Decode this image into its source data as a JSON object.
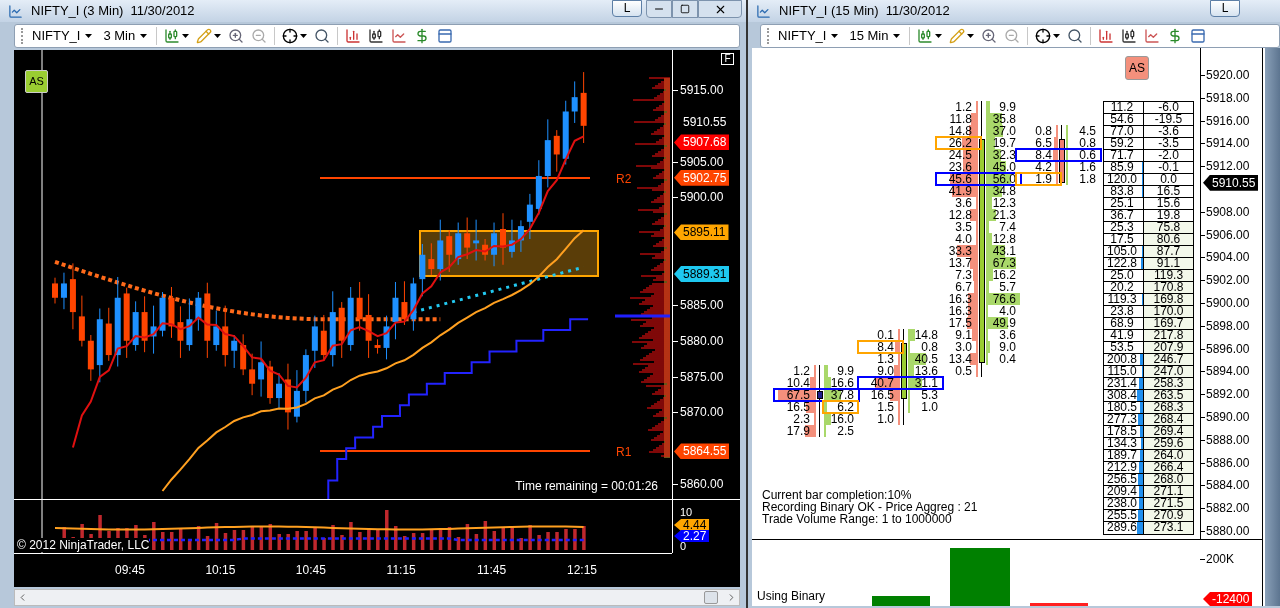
{
  "left_window": {
    "title": "NIFTY_I (3 Min)",
    "date": "11/30/2012",
    "title_buttons": [
      "L"
    ],
    "controls": true,
    "toolbar": {
      "instrument": "NIFTY_I",
      "interval": "3 Min"
    },
    "chart": {
      "as_button": "AS",
      "f_button": "F",
      "price_ticks": [
        "5915.00",
        "5905.00",
        "5900.00",
        "5885.00",
        "5880.00",
        "5875.00",
        "5870.00",
        "5860.00"
      ],
      "price_tags": [
        {
          "text": "5910.55",
          "color": "#000000"
        },
        {
          "text": "5907.68",
          "color": "#ff0000"
        },
        {
          "text": "5902.75",
          "color": "#ff4500"
        },
        {
          "text": "5895.11",
          "color": "#ffa500"
        },
        {
          "text": "5889.31",
          "color": "#1ec8f0"
        },
        {
          "text": "5864.55",
          "color": "#ff4500"
        }
      ],
      "levels": [
        "R2",
        "R1"
      ],
      "time_remaining": "Time remaining = 00:01:26",
      "volume_ticks": [
        "10",
        "0"
      ],
      "volume_tags": [
        {
          "text": "4.44",
          "color": "#ffa500"
        },
        {
          "text": "2.27",
          "color": "#0000ff"
        }
      ],
      "copyright": "© 2012 NinjaTrader, LLC",
      "time_labels": [
        "09:45",
        "10:15",
        "10:45",
        "11:15",
        "11:45",
        "12:15"
      ]
    }
  },
  "right_window": {
    "title": "NIFTY_I (15 Min)",
    "date": "11/30/2012",
    "title_buttons": [
      "L"
    ],
    "controls": false,
    "toolbar": {
      "instrument": "NIFTY_I",
      "interval": "15 Min"
    },
    "chart": {
      "as_button": "AS",
      "footprint": [
        {
          "kind": "flat",
          "rows": [
            {
              "bid": "1.2",
              "ask": "9.9",
              "bid_boxed": false,
              "ask_boxed": false
            },
            {
              "bid": "10.4",
              "ask": "16.6",
              "bid_boxed": false,
              "ask_boxed": false
            },
            {
              "bid": "67.5",
              "ask": "37.8",
              "bid_boxed": true,
              "ask_boxed": true,
              "color": "#0000ff"
            },
            {
              "bid": "16.5",
              "ask": "6.2",
              "bid_boxed": false,
              "ask_boxed": true,
              "color": "#ffa500"
            },
            {
              "bid": "2.3",
              "ask": "16.0",
              "bid_boxed": false,
              "ask_boxed": false
            },
            {
              "bid": "17.9",
              "ask": "2.5",
              "bid_boxed": false,
              "ask_boxed": false
            }
          ]
        },
        {
          "kind": "up",
          "rows": [
            {
              "bid": "0.1",
              "ask": "14.8",
              "bid_boxed": false,
              "ask_boxed": false
            },
            {
              "bid": "8.4",
              "ask": "0.8",
              "bid_boxed": true,
              "ask_boxed": false,
              "color": "#ffa500"
            },
            {
              "bid": "1.3",
              "ask": "40.5",
              "bid_boxed": false,
              "ask_boxed": false
            },
            {
              "bid": "9.0",
              "ask": "13.6",
              "bid_boxed": false,
              "ask_boxed": false
            },
            {
              "bid": "40.7",
              "ask": "31.1",
              "bid_boxed": true,
              "ask_boxed": true,
              "color": "#0000ff"
            },
            {
              "bid": "16.5",
              "ask": "5.3",
              "bid_boxed": false,
              "ask_boxed": false
            },
            {
              "bid": "1.5",
              "ask": "1.0",
              "bid_boxed": false,
              "ask_boxed": false
            },
            {
              "bid": "1.0",
              "bid_boxed": false,
              "ask_boxed": false
            }
          ]
        },
        {
          "kind": "up",
          "rows": [
            {
              "bid": "1.2",
              "ask": "9.9",
              "bid_boxed": false,
              "ask_boxed": false
            },
            {
              "bid": "11.8",
              "ask": "35.8",
              "bid_boxed": false,
              "ask_boxed": false
            },
            {
              "bid": "14.8",
              "ask": "37.0",
              "bid_boxed": false,
              "ask_boxed": false
            },
            {
              "bid": "26.2",
              "ask": "19.7",
              "bid_boxed": true,
              "ask_boxed": false,
              "color": "#ffa500"
            },
            {
              "bid": "24.5",
              "ask": "32.3",
              "bid_boxed": false,
              "ask_boxed": false
            },
            {
              "bid": "23.6",
              "ask": "45.0",
              "bid_boxed": false,
              "ask_boxed": false
            },
            {
              "bid": "45.6",
              "ask": "56.0",
              "bid_boxed": true,
              "ask_boxed": true,
              "color": "#0000ff"
            },
            {
              "bid": "41.9",
              "ask": "34.8",
              "bid_boxed": false,
              "ask_boxed": false
            },
            {
              "bid": "3.6",
              "ask": "12.3",
              "bid_boxed": false,
              "ask_boxed": false
            },
            {
              "bid": "12.8",
              "ask": "21.3",
              "bid_boxed": false,
              "ask_boxed": false
            },
            {
              "bid": "3.5",
              "ask": "7.4",
              "bid_boxed": false,
              "ask_boxed": false
            },
            {
              "bid": "4.0",
              "ask": "12.8",
              "bid_boxed": false,
              "ask_boxed": false
            },
            {
              "bid": "33.3",
              "ask": "43.1",
              "bid_boxed": false,
              "ask_boxed": false
            },
            {
              "bid": "13.7",
              "ask": "67.3",
              "bid_boxed": false,
              "ask_boxed": false
            },
            {
              "bid": "7.3",
              "ask": "16.2",
              "bid_boxed": false,
              "ask_boxed": false
            },
            {
              "bid": "6.7",
              "ask": "5.7",
              "bid_boxed": false,
              "ask_boxed": false
            },
            {
              "bid": "16.3",
              "ask": "76.6",
              "bid_boxed": false,
              "ask_boxed": false
            },
            {
              "bid": "16.3",
              "ask": "4.0",
              "bid_boxed": false,
              "ask_boxed": false
            },
            {
              "bid": "17.5",
              "ask": "49.9",
              "bid_boxed": false,
              "ask_boxed": false
            },
            {
              "bid": "9.1",
              "ask": "3.6",
              "bid_boxed": false,
              "ask_boxed": false
            },
            {
              "bid": "3.0",
              "ask": "9.0",
              "bid_boxed": false,
              "ask_boxed": false
            },
            {
              "bid": "13.4",
              "ask": "0.4",
              "bid_boxed": false,
              "ask_boxed": false
            },
            {
              "bid": "0.5",
              "bid_boxed": false,
              "ask_boxed": false
            }
          ]
        },
        {
          "kind": "down",
          "rows": [
            {
              "bid": "0.8",
              "ask": "4.5",
              "bid_boxed": false,
              "ask_boxed": false
            },
            {
              "bid": "6.5",
              "ask": "0.8",
              "bid_boxed": false,
              "ask_boxed": false
            },
            {
              "bid": "8.4",
              "ask": "0.6",
              "bid_boxed": true,
              "ask_boxed": true,
              "color": "#0000ff"
            },
            {
              "bid": "4.2",
              "ask": "1.6",
              "bid_boxed": false,
              "ask_boxed": false
            },
            {
              "bid": "1.9",
              "ask": "1.8",
              "bid_boxed": true,
              "ask_boxed": false,
              "color": "#ffa500"
            }
          ]
        }
      ],
      "summary_table": [
        [
          "11.2",
          "-6.0"
        ],
        [
          "54.6",
          "-19.5"
        ],
        [
          "77.0",
          "-3.6"
        ],
        [
          "59.2",
          "-3.5"
        ],
        [
          "71.7",
          "-2.0"
        ],
        [
          "85.9",
          "-0.1"
        ],
        [
          "120.0",
          "0.0"
        ],
        [
          "83.8",
          "16.5"
        ],
        [
          "25.1",
          "15.6"
        ],
        [
          "36.7",
          "19.8"
        ],
        [
          "25.3",
          "75.8"
        ],
        [
          "17.5",
          "80.6"
        ],
        [
          "105.0",
          "87.7"
        ],
        [
          "122.8",
          "91.1"
        ],
        [
          "25.0",
          "119.3"
        ],
        [
          "20.2",
          "170.8"
        ],
        [
          "119.3",
          "169.8"
        ],
        [
          "23.8",
          "170.0"
        ],
        [
          "68.9",
          "169.7"
        ],
        [
          "41.9",
          "217.8"
        ],
        [
          "53.5",
          "207.9"
        ],
        [
          "200.8",
          "246.7"
        ],
        [
          "115.0",
          "247.0"
        ],
        [
          "231.4",
          "258.3"
        ],
        [
          "308.4",
          "263.5"
        ],
        [
          "180.5",
          "268.3"
        ],
        [
          "277.3",
          "268.4"
        ],
        [
          "178.5",
          "269.4"
        ],
        [
          "134.3",
          "259.6"
        ],
        [
          "189.7",
          "264.0"
        ],
        [
          "212.9",
          "266.4"
        ],
        [
          "256.5",
          "268.0"
        ],
        [
          "209.4",
          "271.1"
        ],
        [
          "238.0",
          "271.5"
        ],
        [
          "255.5",
          "270.9"
        ],
        [
          "289.6",
          "273.1"
        ]
      ],
      "price_ticks": [
        "5920.00",
        "5918.00",
        "5916.00",
        "5914.00",
        "5912.00",
        "5908.00",
        "5906.00",
        "5904.00",
        "5902.00",
        "5900.00",
        "5898.00",
        "5896.00",
        "5894.00",
        "5892.00",
        "5890.00",
        "5888.00",
        "5886.00",
        "5884.00",
        "5882.00",
        "5880.00"
      ],
      "price_tag": "5910.55",
      "info_lines": [
        "Current bar completion:10%",
        "Recording Binary OK - Price Aggreg : 21",
        "Trade Volume Range: 1 to 1000000"
      ],
      "bottom_tick": "200K",
      "bottom_tag": "-12400",
      "bottom_label": "Using Binary"
    }
  }
}
